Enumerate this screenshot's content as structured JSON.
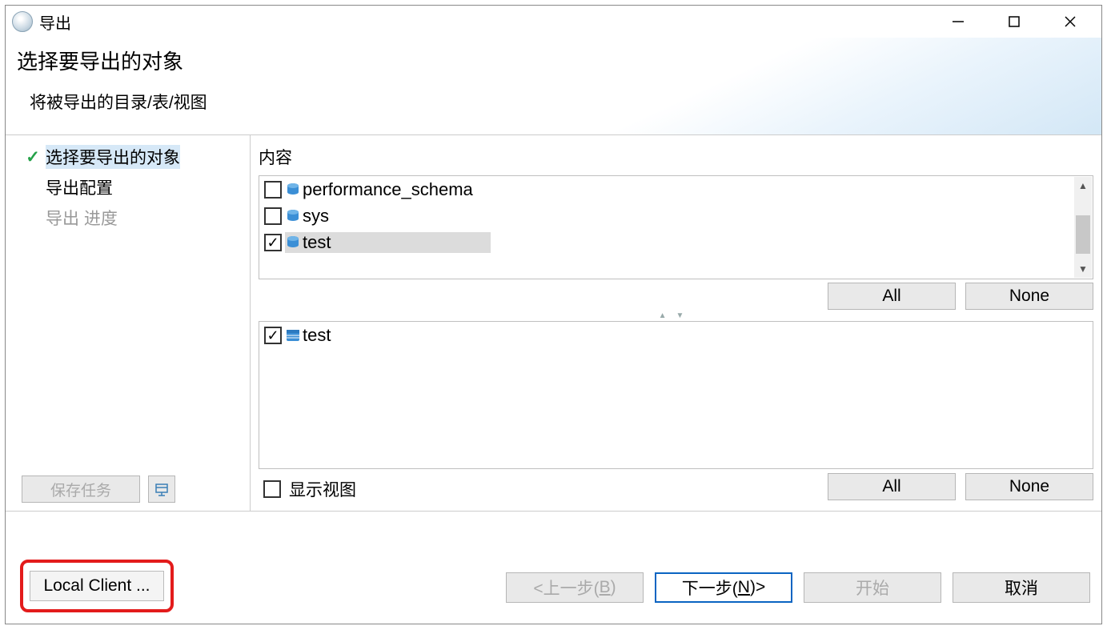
{
  "titlebar": {
    "title": "导出"
  },
  "header": {
    "title": "选择要导出的对象",
    "subtitle": "将被导出的目录/表/视图"
  },
  "steps": {
    "items": [
      {
        "label": "选择要导出的对象",
        "active": true,
        "done": true
      },
      {
        "label": "导出配置",
        "active": false,
        "done": false
      },
      {
        "label": "导出 进度",
        "active": false,
        "done": false,
        "disabled": true
      }
    ],
    "save_task": "保存任务"
  },
  "main": {
    "content_label": "内容",
    "databases": [
      {
        "name": "performance_schema",
        "checked": false,
        "selected": false
      },
      {
        "name": "sys",
        "checked": false,
        "selected": false
      },
      {
        "name": "test",
        "checked": true,
        "selected": true
      }
    ],
    "db_buttons": {
      "all": "All",
      "none": "None"
    },
    "tables": [
      {
        "name": "test",
        "checked": true
      }
    ],
    "tbl_buttons": {
      "all": "All",
      "none": "None"
    },
    "show_views": {
      "label": "显示视图",
      "checked": false
    }
  },
  "footer": {
    "local_client": "Local Client ...",
    "back_prefix": "<上一步(",
    "back_mn": "B",
    "back_suffix": ")",
    "next_prefix": "下一步(",
    "next_mn": "N",
    "next_suffix": ")>",
    "start": "开始",
    "cancel": "取消"
  }
}
